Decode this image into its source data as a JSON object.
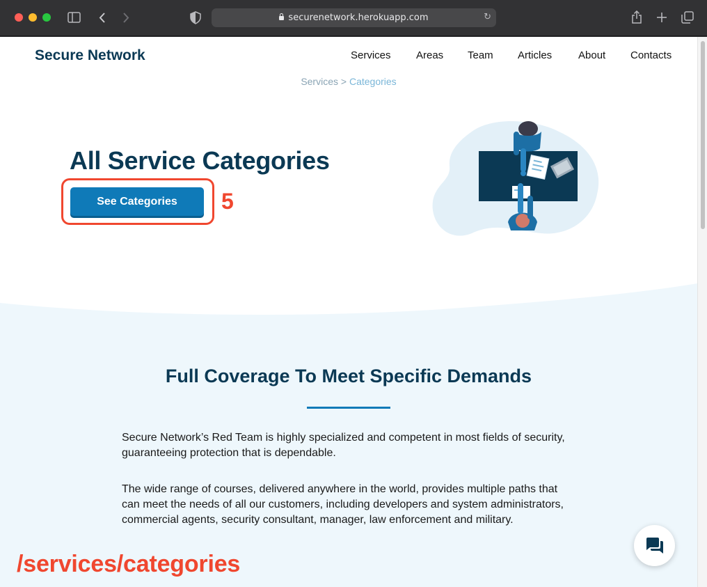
{
  "browser": {
    "url": "securenetwork.herokuapp.com",
    "icons": {
      "sidebar": "sidebar-icon",
      "back": "back-icon",
      "forward": "forward-icon",
      "shield": "shield-icon",
      "share": "share-icon",
      "new_tab": "plus-icon",
      "tabs": "tabs-icon",
      "reload": "reload-icon"
    }
  },
  "site": {
    "brand": "Secure Network",
    "nav": [
      "Services",
      "Areas",
      "Team",
      "Articles",
      "About",
      "Contacts"
    ],
    "breadcrumb": {
      "parent": "Services",
      "separator": ">",
      "current": "Categories"
    }
  },
  "hero": {
    "title": "All Service Categories",
    "button_label": "See Categories"
  },
  "annotation": {
    "step_number": "5",
    "url_caption": "/services/categories",
    "color": "#f0472f"
  },
  "section": {
    "title": "Full Coverage To Meet Specific Demands",
    "paragraphs": [
      "Secure Network’s Red Team is highly specialized and competent in most fields of security, guaranteeing protection that is dependable.",
      "The wide range of courses, delivered anywhere in the world, provides multiple paths that can meet the needs of all our customers, including developers and system administrators, commercial agents, security consultant, manager, law enforcement and military."
    ]
  },
  "colors": {
    "brand": "#0b3954",
    "accent": "#0f7ab8",
    "section_bg": "#eef7fc"
  },
  "chat": {
    "icon": "chat-icon"
  }
}
